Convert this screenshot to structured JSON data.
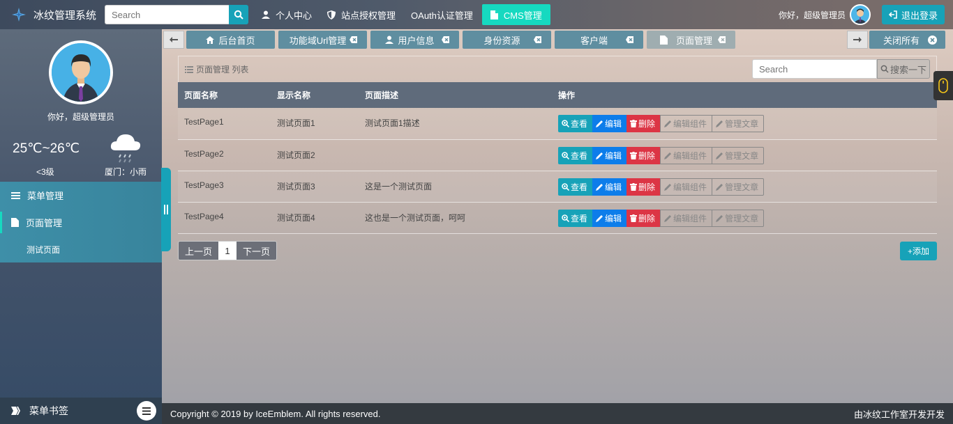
{
  "topbar": {
    "brand_title": "冰纹管理系统",
    "search_placeholder": "Search",
    "nav": [
      {
        "label": "个人中心",
        "icon": "user-icon"
      },
      {
        "label": "站点授权管理",
        "icon": "shield-icon"
      },
      {
        "label": "OAuth认证管理",
        "icon": ""
      },
      {
        "label": "CMS管理",
        "icon": "file-icon",
        "active": true
      }
    ],
    "greeting": "你好，超级管理员",
    "logout_label": "退出登录"
  },
  "sidebar": {
    "greeting": "你好，超级管理员",
    "weather": {
      "temp": "25℃~26℃",
      "wind": "<3级",
      "city": "厦门：小雨",
      "icon": "rain-cloud-icon"
    },
    "menu": [
      {
        "label": "菜单管理",
        "icon": "list-icon"
      },
      {
        "label": "页面管理",
        "icon": "file-icon",
        "active": true
      }
    ],
    "sub_item": "测试页面",
    "footer_label": "菜单书签"
  },
  "tabs": [
    {
      "label": "后台首页",
      "icon": "home-icon"
    },
    {
      "label": "功能域Url管理"
    },
    {
      "label": "用户信息",
      "icon": "user-icon"
    },
    {
      "label": "身份资源"
    },
    {
      "label": "客户端"
    },
    {
      "label": "页面管理",
      "icon": "file-icon",
      "active": true
    }
  ],
  "close_all_label": "关闭所有",
  "panel": {
    "title": "页面管理 列表",
    "search_placeholder": "Search",
    "search_button": "搜索一下",
    "columns": [
      "页面名称",
      "显示名称",
      "页面描述",
      "操作"
    ],
    "rows": [
      {
        "name": "TestPage1",
        "display": "测试页面1",
        "desc": "测试页面1描述"
      },
      {
        "name": "TestPage2",
        "display": "测试页面2",
        "desc": ""
      },
      {
        "name": "TestPage3",
        "display": "测试页面3",
        "desc": "这是一个测试页面"
      },
      {
        "name": "TestPage4",
        "display": "测试页面4",
        "desc": "这也是一个测试页面，呵呵"
      }
    ],
    "actions": {
      "view": "查看",
      "edit": "编辑",
      "delete": "删除",
      "components": "编辑组件",
      "articles": "管理文章"
    },
    "pager": {
      "prev": "上一页",
      "page": "1",
      "next": "下一页"
    },
    "add_label": "+添加"
  },
  "footer": {
    "copyright": "Copyright © 2019 by IceEmblem. All rights reserved.",
    "developer": "由冰纹工作室开发开发"
  },
  "colors": {
    "accent": "#17a2b8",
    "active_nav": "#16d9c0",
    "edit": "#0d7dea",
    "delete": "#dc3545"
  }
}
